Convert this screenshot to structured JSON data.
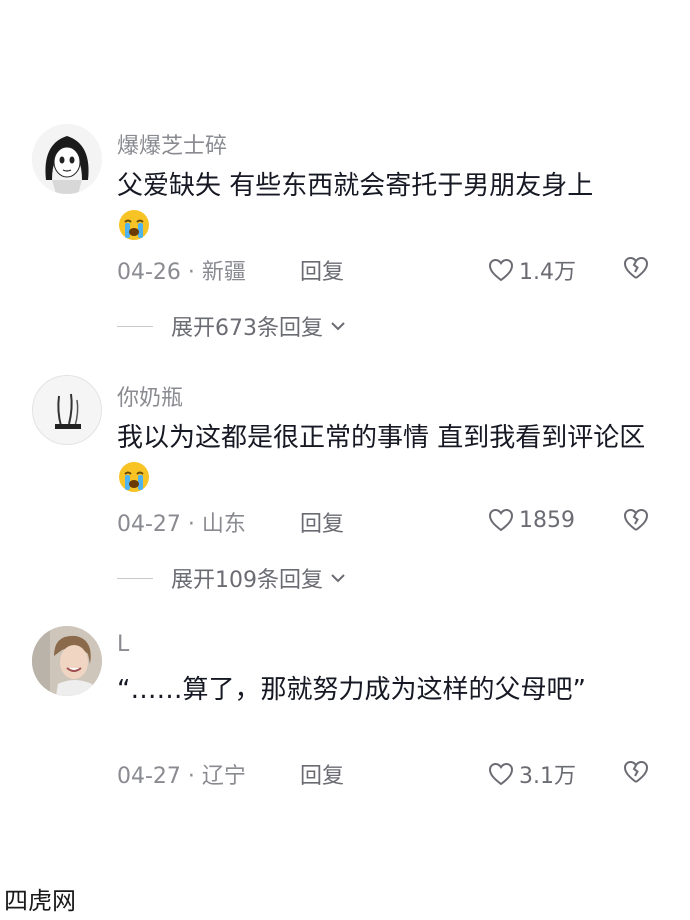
{
  "comments": [
    {
      "username": "爆爆芝士碎",
      "text": "父爱缺失 有些东西就会寄托于男朋友身上",
      "emoji": "loudly-crying-face",
      "date_location": "04-26 · 新疆",
      "reply_label": "回复",
      "likes": "1.4万",
      "expand_label": "展开673条回复"
    },
    {
      "username": "你奶瓶",
      "text": "我以为这都是很正常的事情 直到我看到评论区",
      "emoji": "loudly-crying-face",
      "date_location": "04-27 · 山东",
      "reply_label": "回复",
      "likes": "1859",
      "expand_label": "展开109条回复"
    },
    {
      "username": "L",
      "text": "“……算了，那就努力成为这样的父母吧”",
      "date_location": "04-27 · 辽宁",
      "reply_label": "回复",
      "likes": "3.1万"
    }
  ],
  "watermark": "四虎网",
  "colors": {
    "text_primary": "#161823",
    "text_secondary": "#8a8b91",
    "background": "#ffffff"
  }
}
